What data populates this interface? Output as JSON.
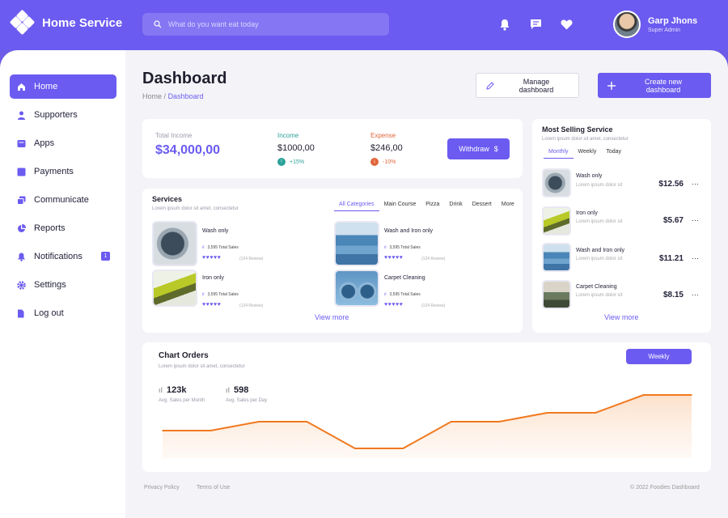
{
  "app": {
    "title": "Home Service"
  },
  "search": {
    "placeholder": "What do you want eat today"
  },
  "user": {
    "name": "Garp Jhons",
    "role": "Super Admin"
  },
  "topbar_icons": [
    "bell-icon",
    "chat-icon",
    "heart-icon"
  ],
  "sidebar": {
    "items": [
      {
        "label": "Home",
        "icon": "home-icon",
        "active": true
      },
      {
        "label": "Supporters",
        "icon": "user-icon"
      },
      {
        "label": "Apps",
        "icon": "apps-icon"
      },
      {
        "label": "Payments",
        "icon": "payments-icon"
      },
      {
        "label": "Communicate",
        "icon": "communicate-icon"
      },
      {
        "label": "Reports",
        "icon": "pie-chart-icon"
      },
      {
        "label": "Notifications",
        "icon": "bell-icon",
        "badge": "1"
      },
      {
        "label": "Settings",
        "icon": "gear-icon"
      },
      {
        "label": "Log out",
        "icon": "logout-icon"
      }
    ]
  },
  "page": {
    "title": "Dashboard",
    "breadcrumb_home": "Home",
    "breadcrumb_sep": "/",
    "breadcrumb_current": "Dashboard",
    "manage_button": "Manage dashboard",
    "create_button": "Create new dashboard"
  },
  "income_card": {
    "total_label": "Total Income",
    "total_value": "$34,000,00",
    "income_label": "Income",
    "income_value": "$1000,00",
    "income_change": "+15%",
    "expense_label": "Expense",
    "expense_value": "$246,00",
    "expense_change": "-10%",
    "withdraw_label": "Withdraw",
    "withdraw_symbol": "$"
  },
  "services": {
    "title": "Services",
    "subtitle": "Lorem ipsum dolor sit amet, consectetur",
    "tabs": [
      "All Categories",
      "Main Course",
      "Pizza",
      "Drink",
      "Dessert",
      "More"
    ],
    "items": [
      {
        "name": "Wash only",
        "sales": "3,595 Total Sales",
        "stars": "♥♥♥♥♥",
        "reviews": "(124 Review)"
      },
      {
        "name": "Wash and Iron only",
        "sales": "3,595 Total Sales",
        "stars": "♥♥♥♥♥",
        "reviews": "(124 Review)"
      },
      {
        "name": "Iron only",
        "sales": "3,595 Total Sales",
        "stars": "♥♥♥♥♥",
        "reviews": "(124 Review)"
      },
      {
        "name": "Carpet Cleaning",
        "sales": "3,595 Total Sales",
        "stars": "♥♥♥♥♥",
        "reviews": "(124 Review)"
      }
    ],
    "view_more": "View more"
  },
  "most_selling": {
    "title": "Most Selling Service",
    "subtitle": "Lorem ipsum dolor sit amet, consectetur",
    "tabs": [
      "Monthly",
      "Weekly",
      "Today"
    ],
    "items": [
      {
        "name": "Wash only",
        "desc": "Lorem ipsum dolor sit",
        "price": "$12.56"
      },
      {
        "name": "Iron only",
        "desc": "Lorem ipsum dolor sit",
        "price": "$5.67"
      },
      {
        "name": "Wash and Iron only",
        "desc": "Lorem ipsum dolor sit",
        "price": "$11.21"
      },
      {
        "name": "Carpet Cleaning",
        "desc": "Lorem ipsum dolor sit",
        "price": "$8.15"
      }
    ],
    "more_symbol": "···",
    "view_more": "View more"
  },
  "chart_orders": {
    "title": "Chart Orders",
    "subtitle": "Lorem ipsum dolor sit amet, consectetur",
    "period_button": "Weekly",
    "stat1_value": "123k",
    "stat1_label": "Avg. Sales per Month",
    "stat2_value": "598",
    "stat2_label": "Avg. Sales per Day"
  },
  "chart_data": {
    "type": "line",
    "x": [
      0,
      1,
      2,
      3,
      4,
      5,
      6,
      7,
      8,
      9,
      10,
      11
    ],
    "series": [
      {
        "values": [
          2,
          2,
          3,
          3,
          0,
          0,
          3,
          3,
          4,
          4,
          6,
          6
        ]
      }
    ],
    "ylim": [
      0,
      6
    ],
    "grid": false,
    "color": "#f0791f"
  },
  "footer": {
    "privacy": "Privacy Policy",
    "terms": "Terms of Use",
    "copyright": "© 2022 Foodies Dashboard"
  },
  "colors": {
    "accent": "#6b5bf0",
    "income": "#2aa198",
    "expense": "#e0663c",
    "line": "#f0791f"
  }
}
